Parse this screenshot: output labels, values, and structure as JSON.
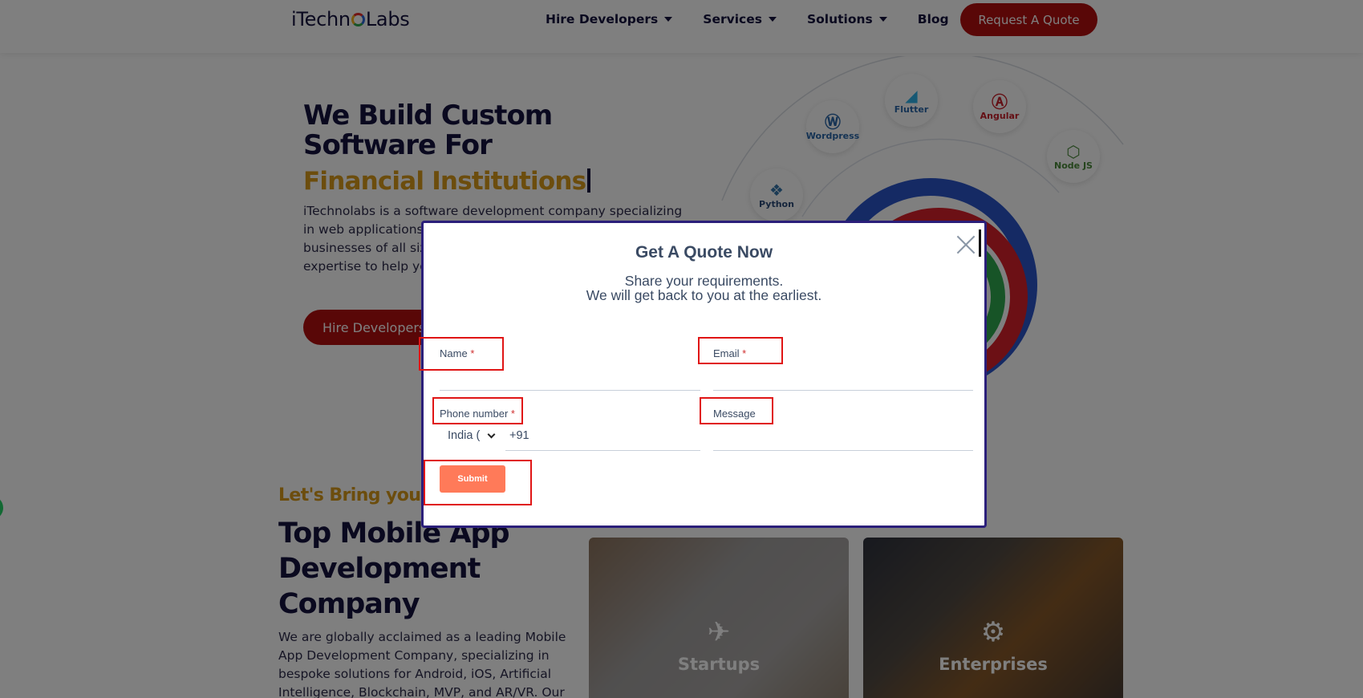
{
  "header": {
    "logo": "iTechnoLabs",
    "nav": [
      {
        "label": "Hire Developers",
        "has_dropdown": true
      },
      {
        "label": "Services",
        "has_dropdown": true
      },
      {
        "label": "Solutions",
        "has_dropdown": true
      },
      {
        "label": "Blog",
        "has_dropdown": false
      }
    ],
    "cta": "Request A Quote"
  },
  "hero": {
    "title": "We Build Custom Software For",
    "typed": "Financial Institutions",
    "text": "iTechnolabs is a software development company specializing in web applications, mobile apps, and digital solutions for businesses of all sizes. We combine technology and business expertise to help you achieve your objectives.",
    "button": "Hire Developers",
    "tech_badges": [
      "Wordpress",
      "Flutter",
      "Angular",
      "Node JS",
      "Python"
    ]
  },
  "section2": {
    "kicker": "Let's Bring your Idea to Life",
    "title": "Top Mobile App Development Company",
    "text": "We are globally acclaimed as a leading Mobile App Development Company, specializing in bespoke solutions for Android, iOS, Artificial Intelligence, Blockchain, MVP, and AR/VR. Our",
    "cards": [
      {
        "label": "Startups"
      },
      {
        "label": "Enterprises"
      }
    ]
  },
  "modal": {
    "title": "Get A Quote Now",
    "subtitle_line1": "Share your requirements.",
    "subtitle_line2": "We will get back to you at the earliest.",
    "fields": {
      "name": {
        "label": "Name",
        "required_mark": "*"
      },
      "email": {
        "label": "Email",
        "required_mark": "*"
      },
      "phone": {
        "label": "Phone number",
        "required_mark": "*",
        "country": "India (",
        "dial_code": "+91"
      },
      "message": {
        "label": "Message"
      }
    },
    "submit": "Submit"
  },
  "colors": {
    "brand_red": "#b20f0f",
    "accent_gold": "#d99a1a",
    "navy": "#15133f",
    "submit": "#ff7a59",
    "highlight": "#e01515"
  }
}
